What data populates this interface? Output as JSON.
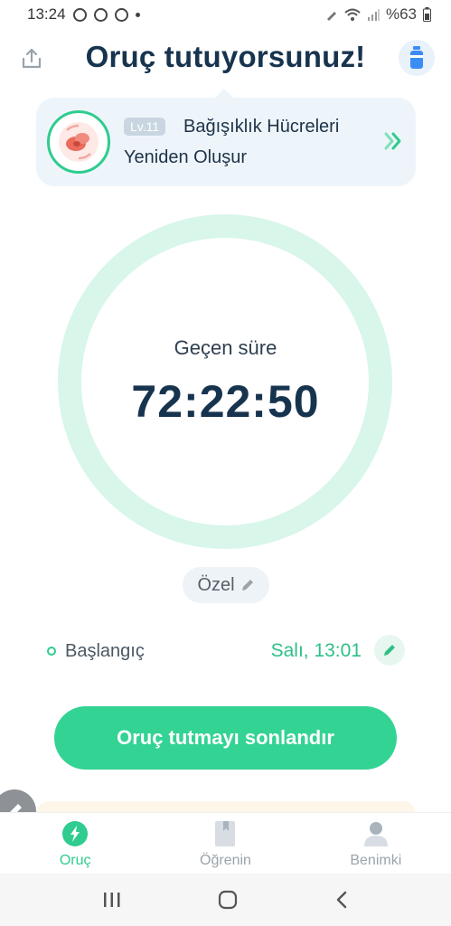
{
  "status_bar": {
    "time": "13:24",
    "battery": "%63"
  },
  "header": {
    "title": "Oruç tutuyorsunuz!"
  },
  "level_card": {
    "level": "Lv.11",
    "line1": "Bağışıklık Hücreleri",
    "line2": "Yeniden Oluşur"
  },
  "timer": {
    "label": "Geçen süre",
    "elapsed": "72:22:50",
    "ring_color": "#d8f6ea"
  },
  "plan": {
    "label": "Özel"
  },
  "start": {
    "label": "Başlangıç",
    "value": "Salı, 13:01"
  },
  "end_button": {
    "label": "Oruç tutmayı sonlandır",
    "color": "#33d393"
  },
  "bottom_nav": {
    "items": [
      {
        "label": "Oruç",
        "icon": "lightning-icon",
        "active": true
      },
      {
        "label": "Öğrenin",
        "icon": "book-icon",
        "active": false
      },
      {
        "label": "Benimki",
        "icon": "person-icon",
        "active": false
      }
    ]
  },
  "colors": {
    "accent": "#2ecc8e",
    "title": "#17344f"
  }
}
